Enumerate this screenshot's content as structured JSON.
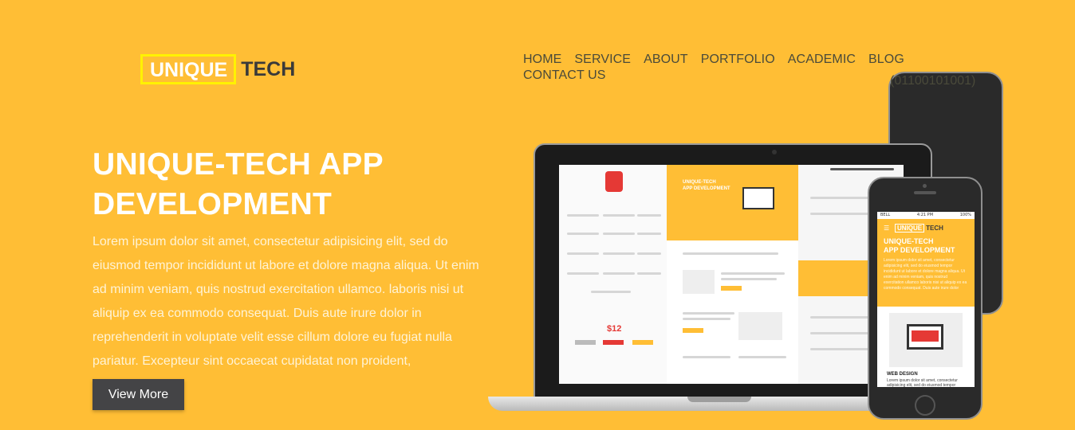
{
  "logo": {
    "box_text": "UNIQUE",
    "tech_text": "TECH"
  },
  "nav": {
    "items": [
      "HOME",
      "SERVICE",
      "ABOUT",
      "PORTFOLIO",
      "ACADEMIC",
      "BLOG",
      "CONTACT US"
    ],
    "phone": "(01100101001)"
  },
  "hero": {
    "title_line1": "UNIQUE-TECH APP",
    "title_line2": "DEVELOPMENT",
    "text": "Lorem ipsum dolor sit amet, consectetur adipisicing elit, sed do eiusmod tempor incididunt ut labore et dolore magna aliqua. Ut enim ad minim veniam, quis nostrud exercitation ullamco. laboris nisi ut aliquip ex ea commodo consequat. Duis aute irure dolor in reprehenderit in voluptate velit esse cillum dolore eu fugiat nulla pariatur. Excepteur sint occaecat cupidatat non proident,",
    "button_label": "View More"
  },
  "mockup": {
    "laptop_title_line1": "UNIQUE-TECH",
    "laptop_title_line2": "APP DEVELOPMENT",
    "laptop_price": "$12",
    "phone_status_carrier": "BELL",
    "phone_status_time": "4:21 PM",
    "phone_status_battery": "100%",
    "phone_logo_box": "UNIQUE",
    "phone_logo_tech": "TECH",
    "phone_title_line1": "UNIQUE-TECH",
    "phone_title_line2": "APP DEVELOPMENT",
    "phone_text": "Lorem ipsum dolor sit amet, consectetur adipisicing elit, sed do eiusmod tempor incididunt ut labore et dolore magna aliqua. Ut enim ad minim veniam, quis nostrud exercitation ullamco laboris nisi ut aliquip ex ea commodo consequat. Duis aute irure dolor",
    "phone_section": "WEB DESIGN",
    "phone_section_text": "Lorem ipsum dolor sit amet, consectetur adipisicing elit, sed do eiusmod tempor incididunt ut labore et dolore magna aliqua. Ut enim ad minim veniam, quis nostrud"
  },
  "colors": {
    "background": "#FFBE35",
    "button": "#444446",
    "logo_border": "#FFF200"
  }
}
